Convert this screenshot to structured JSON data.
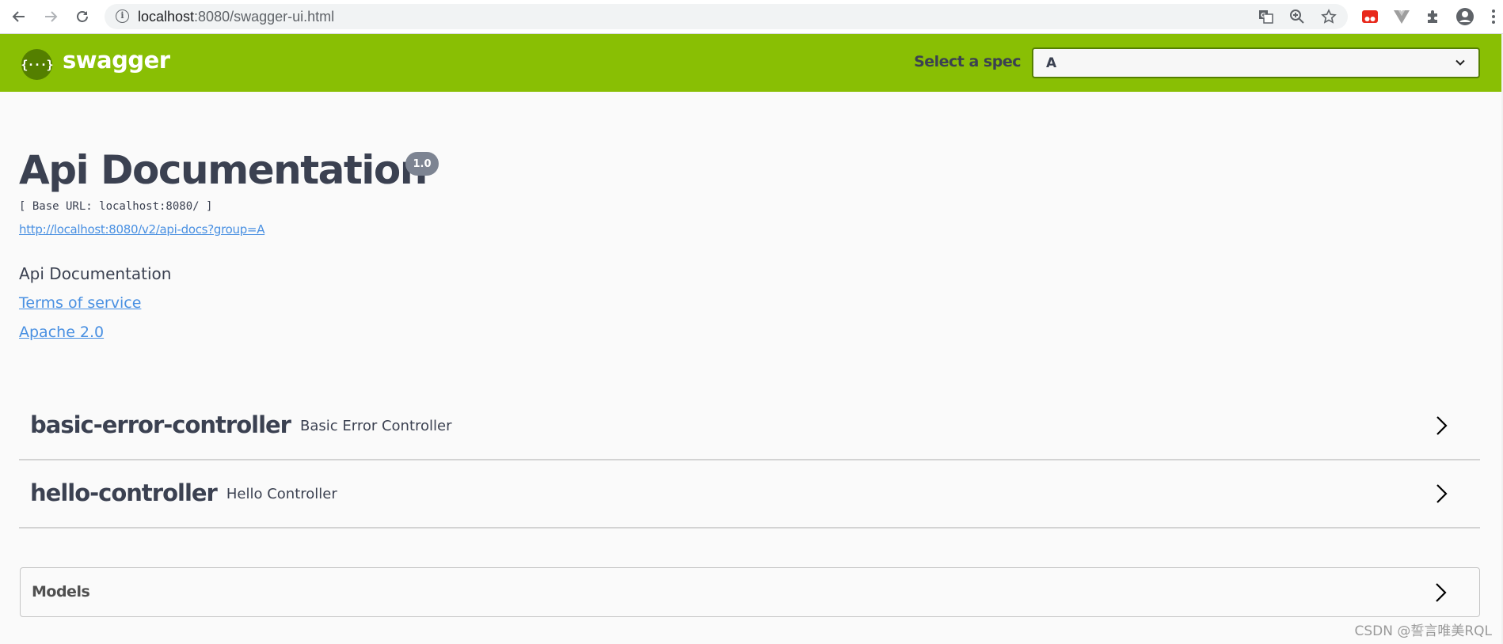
{
  "browser": {
    "url_host": "localhost",
    "url_rest": ":8080/swagger-ui.html",
    "icons": [
      "back-icon",
      "forward-icon",
      "reload-icon",
      "site-info-icon",
      "translate-icon",
      "zoom-icon",
      "bookmark-star-icon",
      "extension-red-icon",
      "extension-vue-icon",
      "extensions-puzzle-icon",
      "profile-icon",
      "menu-dots-icon"
    ]
  },
  "topbar": {
    "logo_glyph": "{···}",
    "logo_text": "swagger",
    "spec_label": "Select a spec",
    "spec_selected": "A",
    "colors": {
      "background": "#89bf04",
      "logo_circle": "#547f00",
      "select_border": "#547f00"
    }
  },
  "info": {
    "title": "Api Documentation",
    "version": "1.0",
    "base_url": "[ Base URL: localhost:8080/ ]",
    "spec_url": "http://localhost:8080/v2/api-docs?group=A",
    "description": "Api Documentation",
    "terms_label": "Terms of service",
    "license_label": "Apache 2.0",
    "colors": {
      "text": "#3b4151",
      "link": "#4990e2",
      "badge": "#7d8492"
    }
  },
  "tags": [
    {
      "name": "basic-error-controller",
      "description": "Basic Error Controller"
    },
    {
      "name": "hello-controller",
      "description": "Hello Controller"
    }
  ],
  "models": {
    "title": "Models"
  },
  "watermark": "CSDN @誓言唯美RQL"
}
